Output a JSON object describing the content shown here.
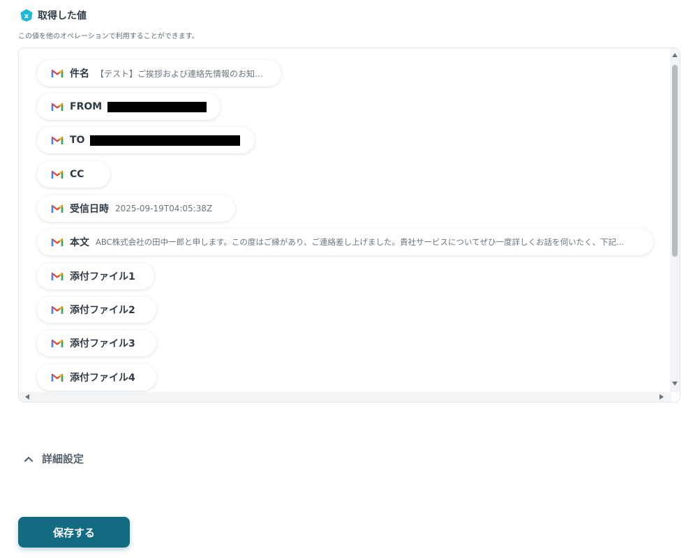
{
  "section": {
    "title": "取得した値",
    "description": "この値を他のオペレーションで利用することができます。",
    "icon": "variable-x-icon",
    "icon_color": "#1fb8d6"
  },
  "fields": [
    {
      "label": "件名",
      "value": "【テスト】ご挨拶および連絡先情報のお知らせ",
      "icon": "gmail-icon"
    },
    {
      "label": "FROM",
      "value": "",
      "redacted": true,
      "icon": "gmail-icon"
    },
    {
      "label": "TO",
      "value": "",
      "redacted": true,
      "icon": "gmail-icon"
    },
    {
      "label": "CC",
      "value": "",
      "icon": "gmail-icon"
    },
    {
      "label": "受信日時",
      "value": "2025-09-19T04:05:38Z",
      "icon": "gmail-icon"
    },
    {
      "label": "本文",
      "value": "ABC株式会社の田中一郎と申します。この度はご縁があり、ご連絡差し上げました。貴社サービスについてぜひ一度詳しくお話を伺いたく、下記...",
      "icon": "gmail-icon"
    },
    {
      "label": "添付ファイル1",
      "value": "",
      "icon": "gmail-icon"
    },
    {
      "label": "添付ファイル2",
      "value": "",
      "icon": "gmail-icon"
    },
    {
      "label": "添付ファイル3",
      "value": "",
      "icon": "gmail-icon"
    },
    {
      "label": "添付ファイル4",
      "value": "",
      "icon": "gmail-icon"
    }
  ],
  "advanced": {
    "label": "詳細設定",
    "icon": "chevron-up-icon"
  },
  "save_button": {
    "label": "保存する",
    "color": "#136b82"
  }
}
